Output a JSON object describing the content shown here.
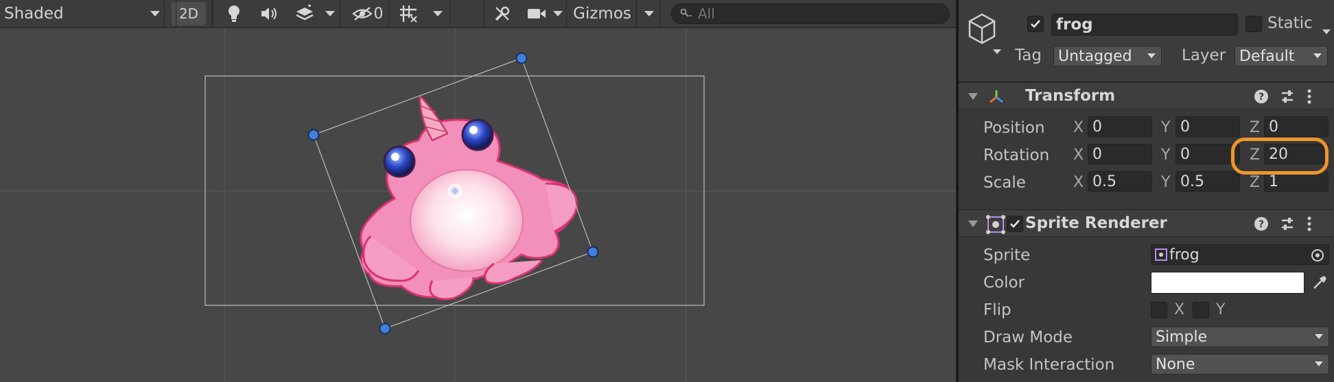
{
  "toolbar": {
    "shading_mode": "Shaded",
    "mode_2d_label": "2D",
    "hidden_count": "0",
    "gizmos_label": "Gizmos",
    "search_placeholder": "All"
  },
  "inspector": {
    "object_name": "frog",
    "static_label": "Static",
    "tag_label": "Tag",
    "tag_value": "Untagged",
    "layer_label": "Layer",
    "layer_value": "Default",
    "active": true,
    "is_static": false
  },
  "transform": {
    "title": "Transform",
    "rows": [
      {
        "label": "Position",
        "x": "0",
        "y": "0",
        "z": "0"
      },
      {
        "label": "Rotation",
        "x": "0",
        "y": "0",
        "z": "20"
      },
      {
        "label": "Scale",
        "x": "0.5",
        "y": "0.5",
        "z": "1"
      }
    ],
    "axis_x": "X",
    "axis_y": "Y",
    "axis_z": "Z"
  },
  "sprite_renderer": {
    "title": "Sprite Renderer",
    "enabled": true,
    "sprite_label": "Sprite",
    "sprite_value": "frog",
    "color_label": "Color",
    "color_value": "#ffffff",
    "flip_label": "Flip",
    "flip_x": "X",
    "flip_y": "Y",
    "draw_mode_label": "Draw Mode",
    "draw_mode_value": "Simple",
    "mask_label": "Mask Interaction",
    "mask_value": "None"
  },
  "colors": {
    "highlight": "#f0962b",
    "handle": "#3f7fe0",
    "frog_pink": "#f08fba"
  }
}
